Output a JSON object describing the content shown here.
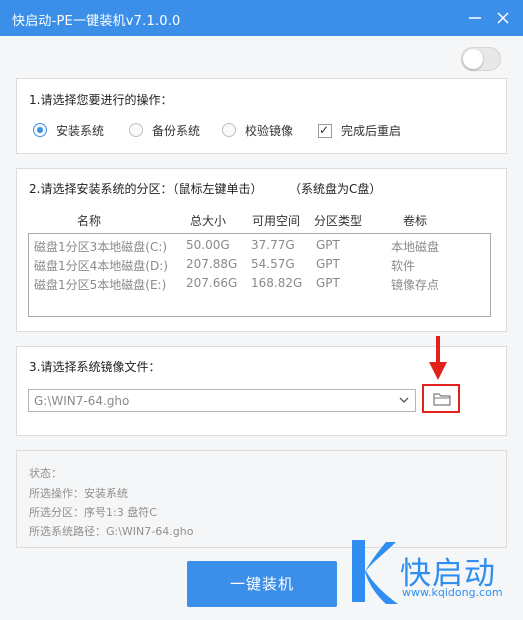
{
  "window": {
    "title": "快启动-PE一键装机v7.1.0.0"
  },
  "toggle": {
    "state": "off"
  },
  "section1": {
    "title": "1.请选择您要进行的操作：",
    "options": [
      {
        "label": "安装系统",
        "selected": true
      },
      {
        "label": "备份系统",
        "selected": false
      },
      {
        "label": "校验镜像",
        "selected": false
      }
    ],
    "checkbox": {
      "label": "完成后重启",
      "checked": true
    }
  },
  "section2": {
    "title": "2.请选择安装系统的分区：（鼠标左键单击）",
    "note": "（系统盘为C盘）",
    "columns": [
      "名称",
      "总大小",
      "可用空间",
      "分区类型",
      "卷标"
    ],
    "rows": [
      {
        "name": "磁盘1分区3本地磁盘(C:)",
        "total": "50.00G",
        "free": "37.77G",
        "type": "GPT",
        "label": "本地磁盘"
      },
      {
        "name": "磁盘1分区4本地磁盘(D:)",
        "total": "207.88G",
        "free": "54.57G",
        "type": "GPT",
        "label": "软件"
      },
      {
        "name": "磁盘1分区5本地磁盘(E:)",
        "total": "207.66G",
        "free": "168.82G",
        "type": "GPT",
        "label": "镜像存点"
      }
    ]
  },
  "section3": {
    "title": "3.请选择系统镜像文件：",
    "image_path": "G:\\WIN7-64.gho"
  },
  "status": {
    "state_label": "状态：",
    "operation": "所选操作：安装系统",
    "partition": "所选分区：序号1:3    盘符C",
    "path": "所选系统路径：G:\\WIN7-64.gho"
  },
  "install_button": "一键装机",
  "brand": {
    "name": "快启动",
    "url": "www.kqidong.com"
  },
  "colors": {
    "accent": "#3b8fe8",
    "highlight": "#e0211c"
  }
}
